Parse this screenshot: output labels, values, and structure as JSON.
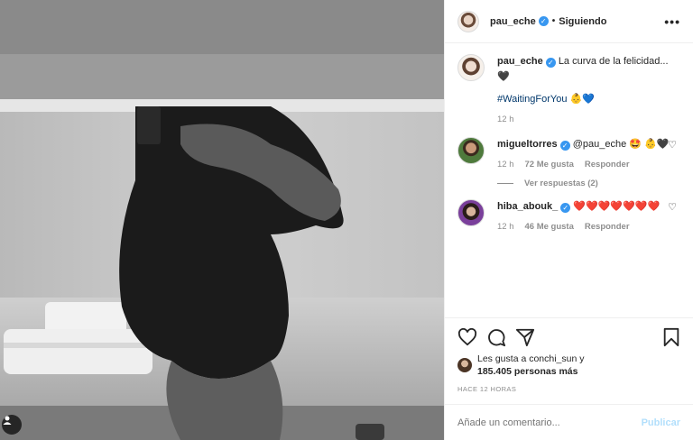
{
  "post": {
    "author": "pau_eche",
    "follow_status": "Siguiendo",
    "dot": "•",
    "more": "•••"
  },
  "caption": {
    "author": "pau_eche",
    "text": "La curva de la felicidad... 🖤",
    "hashtag": "#WaitingForYou 👶💙",
    "time": "12 h"
  },
  "comments": [
    {
      "author": "migueltorres",
      "text": "@pau_eche 🤩 👶🖤",
      "time": "12 h",
      "likes": "72 Me gusta",
      "reply": "Responder",
      "view_replies": "Ver respuestas (2)"
    },
    {
      "author": "hiba_abouk_",
      "text": "❤️❤️❤️❤️❤️❤️❤️",
      "time": "12 h",
      "likes": "46 Me gusta",
      "reply": "Responder"
    }
  ],
  "likes": {
    "line1": "Les gusta a conchi_sun y",
    "line2": "185.405 personas más"
  },
  "timestamp": "HACE 12 HORAS",
  "comment_box": {
    "placeholder": "Añade un comentario...",
    "post_label": "Publicar"
  },
  "icons": {
    "verified": "✓",
    "heart": "♡"
  }
}
